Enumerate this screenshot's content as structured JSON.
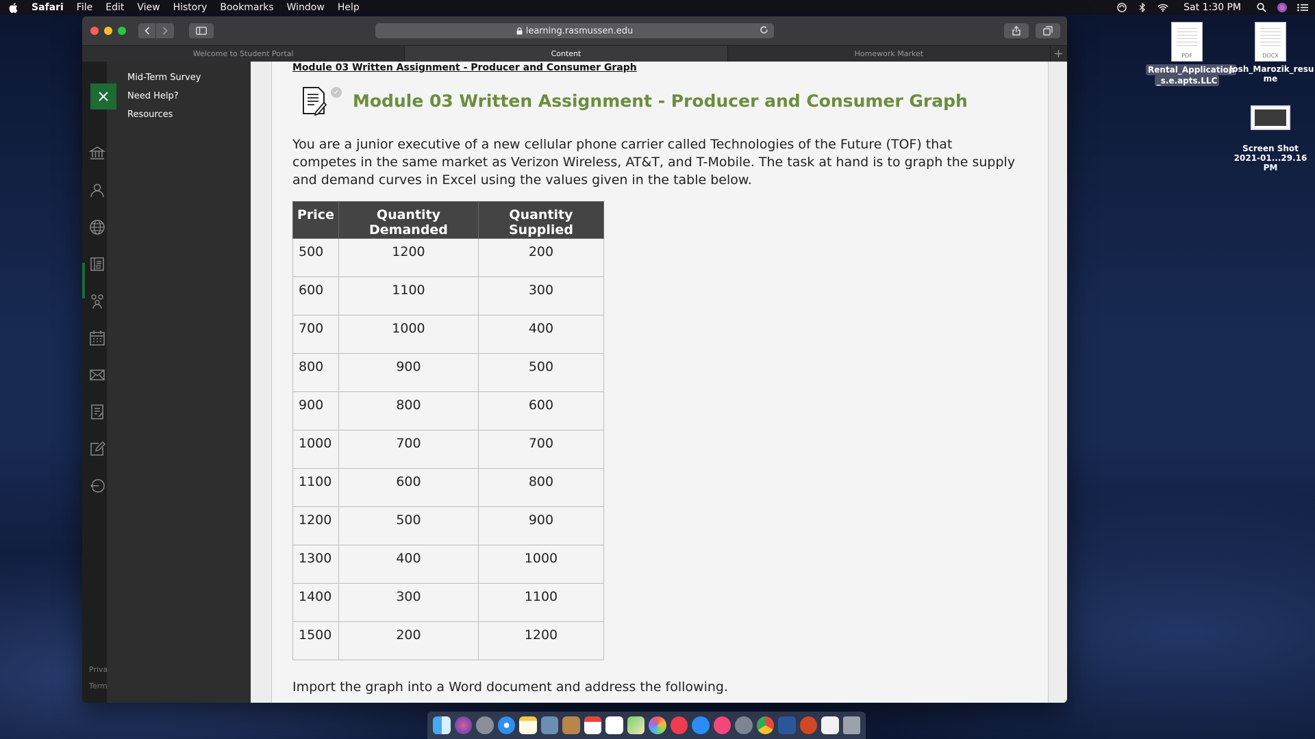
{
  "menubar": {
    "app": "Safari",
    "items": [
      "File",
      "Edit",
      "View",
      "History",
      "Bookmarks",
      "Window",
      "Help"
    ],
    "clock": "Sat 1:30 PM"
  },
  "desktop": {
    "icons": [
      {
        "label": "Rental_Application_s.e.apts.LLC",
        "line1": "Rental_Application",
        "line2": "_s.e.apts.LLC",
        "type": "PDF"
      },
      {
        "label": "Josh_Marozik_resume",
        "line1": "Josh_Marozik_resu",
        "line2": "me",
        "type": "DOCX"
      },
      {
        "label": "Screen Shot 2021-01...29.16 PM",
        "line1": "Screen Shot",
        "line2": "2021-01...29.16 PM"
      }
    ]
  },
  "browser": {
    "url": "learning.rasmussen.edu",
    "tabs": [
      "Welcome to Student Portal",
      "Content",
      "Homework Market"
    ],
    "active_tab": 1
  },
  "nav": {
    "items": [
      "Mid-Term Survey",
      "Need Help?",
      "Resources"
    ],
    "footer": [
      "Priva",
      "Term"
    ]
  },
  "page": {
    "breadcrumb": "Module 03 Written Assignment - Producer and Consumer Graph",
    "title": "Module 03 Written Assignment - Producer and Consumer Graph",
    "intro": "You are a junior executive of a new cellular phone carrier called Technologies of the Future (TOF) that competes in the same market as Verizon Wireless, AT&T, and T-Mobile. The task at hand is to graph the supply and demand curves in Excel using the values given in the table below.",
    "table": {
      "headers": [
        "Price",
        "Quantity Demanded",
        "Quantity Supplied"
      ],
      "rows": [
        [
          "500",
          "1200",
          "200"
        ],
        [
          "600",
          "1100",
          "300"
        ],
        [
          "700",
          "1000",
          "400"
        ],
        [
          "800",
          "900",
          "500"
        ],
        [
          "900",
          "800",
          "600"
        ],
        [
          "1000",
          "700",
          "700"
        ],
        [
          "1100",
          "600",
          "800"
        ],
        [
          "1200",
          "500",
          "900"
        ],
        [
          "1300",
          "400",
          "1000"
        ],
        [
          "1400",
          "300",
          "1100"
        ],
        [
          "1500",
          "200",
          "1200"
        ]
      ]
    },
    "outro": "Import the graph into a Word document and address the following."
  },
  "colors": {
    "accent_green": "#1e6b34",
    "title_green": "#6b8e3e",
    "table_header": "#444444"
  }
}
